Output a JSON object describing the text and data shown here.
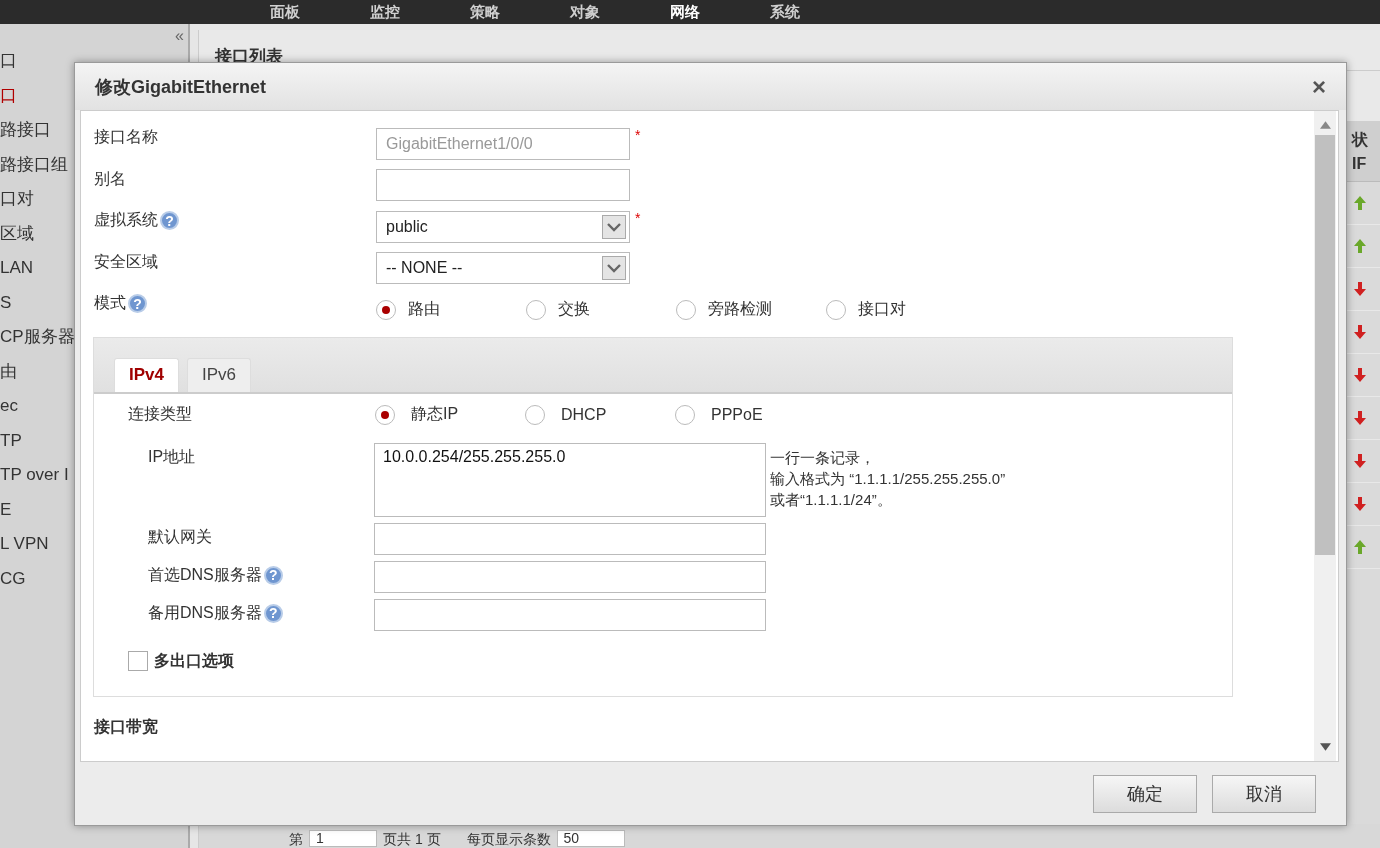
{
  "top_nav": {
    "items": [
      {
        "label": "面板",
        "selected": false
      },
      {
        "label": "监控",
        "selected": false
      },
      {
        "label": "策略",
        "selected": false
      },
      {
        "label": "对象",
        "selected": false
      },
      {
        "label": "网络",
        "selected": true
      },
      {
        "label": "系统",
        "selected": false
      }
    ]
  },
  "sidebar": {
    "collapse": "«",
    "items": [
      {
        "label": "口",
        "selected": false
      },
      {
        "label": "口",
        "selected": true
      },
      {
        "label": "路接口",
        "selected": false
      },
      {
        "label": "路接口组",
        "selected": false
      },
      {
        "label": "口对",
        "selected": false
      },
      {
        "label": "区域",
        "selected": false
      },
      {
        "label": "LAN",
        "selected": false
      },
      {
        "label": "S",
        "selected": false
      },
      {
        "label": "CP服务器",
        "selected": false
      },
      {
        "label": "由",
        "selected": false
      },
      {
        "label": "ec",
        "selected": false
      },
      {
        "label": "TP",
        "selected": false
      },
      {
        "label": "TP over I",
        "selected": false
      },
      {
        "label": "E",
        "selected": false
      },
      {
        "label": "L VPN",
        "selected": false
      },
      {
        "label": "CG",
        "selected": false
      }
    ]
  },
  "panel": {
    "title": "接口列表"
  },
  "table": {
    "header": [
      "状",
      "IF"
    ],
    "rows": [
      {
        "kind": "up"
      },
      {
        "kind": "up"
      },
      {
        "kind": "down"
      },
      {
        "kind": "down"
      },
      {
        "kind": "down"
      },
      {
        "kind": "down"
      },
      {
        "kind": "down"
      },
      {
        "kind": "down"
      },
      {
        "kind": "up"
      }
    ]
  },
  "pagination": {
    "page_label": "第",
    "page": "1",
    "total": "页共 1 页",
    "per_page_label": "每页显示条数",
    "per_page": "50"
  },
  "dialog": {
    "title": "修改GigabitEthernet",
    "close": "×",
    "fields": [
      {
        "kind": "text",
        "label": "接口名称",
        "value": "GigabitEthernet1/0/0",
        "disabled": true,
        "required_mark": "*"
      },
      {
        "kind": "text",
        "label": "别名"
      },
      {
        "kind": "select",
        "label": "虚拟系统",
        "help": "?",
        "value": "public",
        "required_mark": "*"
      },
      {
        "kind": "select",
        "label": "安全区域",
        "value": "-- NONE --"
      },
      {
        "kind": "radio",
        "label": "模式",
        "help": "?",
        "options": [
          {
            "label": "路由",
            "selected": true
          },
          {
            "label": "交换",
            "selected": false
          },
          {
            "label": "旁路检测",
            "selected": false
          },
          {
            "label": "接口对",
            "selected": false
          }
        ]
      }
    ],
    "tabs": [
      {
        "label": "IPv4",
        "selected": true
      },
      {
        "label": "IPv6",
        "selected": false
      }
    ],
    "connection": {
      "label": "连接类型",
      "options": [
        {
          "label": "静态IP",
          "selected": true
        },
        {
          "label": "DHCP",
          "selected": false
        },
        {
          "label": "PPPoE",
          "selected": false
        }
      ]
    },
    "ip_address": {
      "label": "IP地址",
      "value": "10.0.0.254/255.255.255.0",
      "hint": [
        "一行一条记录，",
        "输入格式为 “1.1.1.1/255.255.255.0”",
        "或者“1.1.1.1/24”。"
      ]
    },
    "ip_fields": [
      {
        "label": "默认网关"
      },
      {
        "label": "首选DNS服务器",
        "help": "?"
      },
      {
        "label": "备用DNS服务器",
        "help": "?"
      }
    ],
    "multi_exit": {
      "label": "多出口选项",
      "checked": false
    },
    "section": "接口带宽",
    "buttons": [
      "确定",
      "取消"
    ]
  }
}
